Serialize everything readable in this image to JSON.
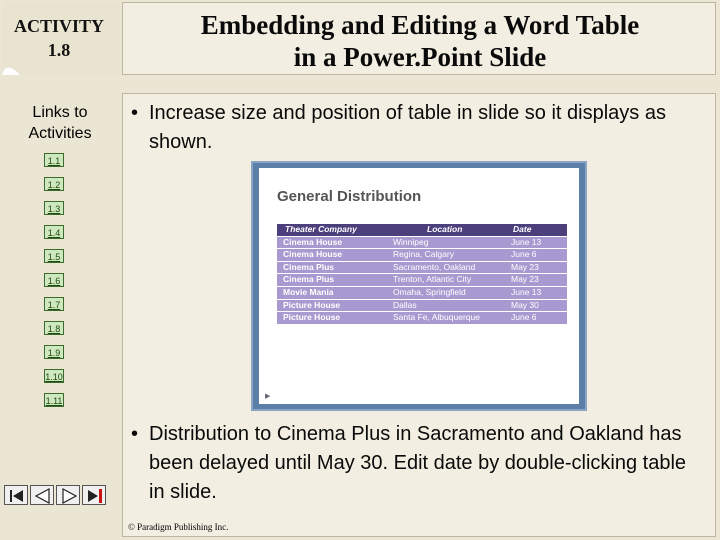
{
  "activity": {
    "label": "ACTIVITY",
    "number": "1.8"
  },
  "links": {
    "title_line1": "Links to",
    "title_line2": "Activities",
    "items": [
      "1.1",
      "1.2",
      "1.3",
      "1.4",
      "1.5",
      "1.6",
      "1.7",
      "1.8",
      "1.9",
      "1.10",
      "1.11"
    ]
  },
  "title": {
    "line1": "Embedding and Editing a Word Table",
    "line2": "in a Power.Point Slide"
  },
  "bullets": [
    {
      "marker": "•",
      "text": "Increase size and position of table in slide so it displays as shown."
    },
    {
      "marker": "•",
      "text": "Distribution to Cinema Plus in Sacramento and Oakland has been delayed until May 30. Edit date by double-clicking table in slide."
    }
  ],
  "slide": {
    "heading": "General Distribution",
    "columns": [
      "Theater Company",
      "Location",
      "Date"
    ],
    "rows": [
      [
        "Cinema House",
        "Winnipeg",
        "June 13"
      ],
      [
        "Cinema House",
        "Regina, Calgary",
        "June 6"
      ],
      [
        "Cinema Plus",
        "Sacramento, Oakland",
        "May 23"
      ],
      [
        "Cinema Plus",
        "Trenton, Atlantic City",
        "May 23"
      ],
      [
        "Movie Mania",
        "Omaha, Springfield",
        "June 13"
      ],
      [
        "Picture House",
        "Dallas",
        "May 30"
      ],
      [
        "Picture House",
        "Santa Fe, Albuquerque",
        "June 6"
      ]
    ]
  },
  "copyright": "© Paradigm Publishing Inc.",
  "colors": {
    "background": "#ebe6d3",
    "panel": "#f2efe2",
    "table_header": "#4b3f7c",
    "table_row": "#a89ad0",
    "nav_button": "#cfe8bf"
  },
  "icons": [
    "first-slide-icon",
    "previous-slide-icon",
    "next-slide-icon",
    "last-slide-icon"
  ]
}
